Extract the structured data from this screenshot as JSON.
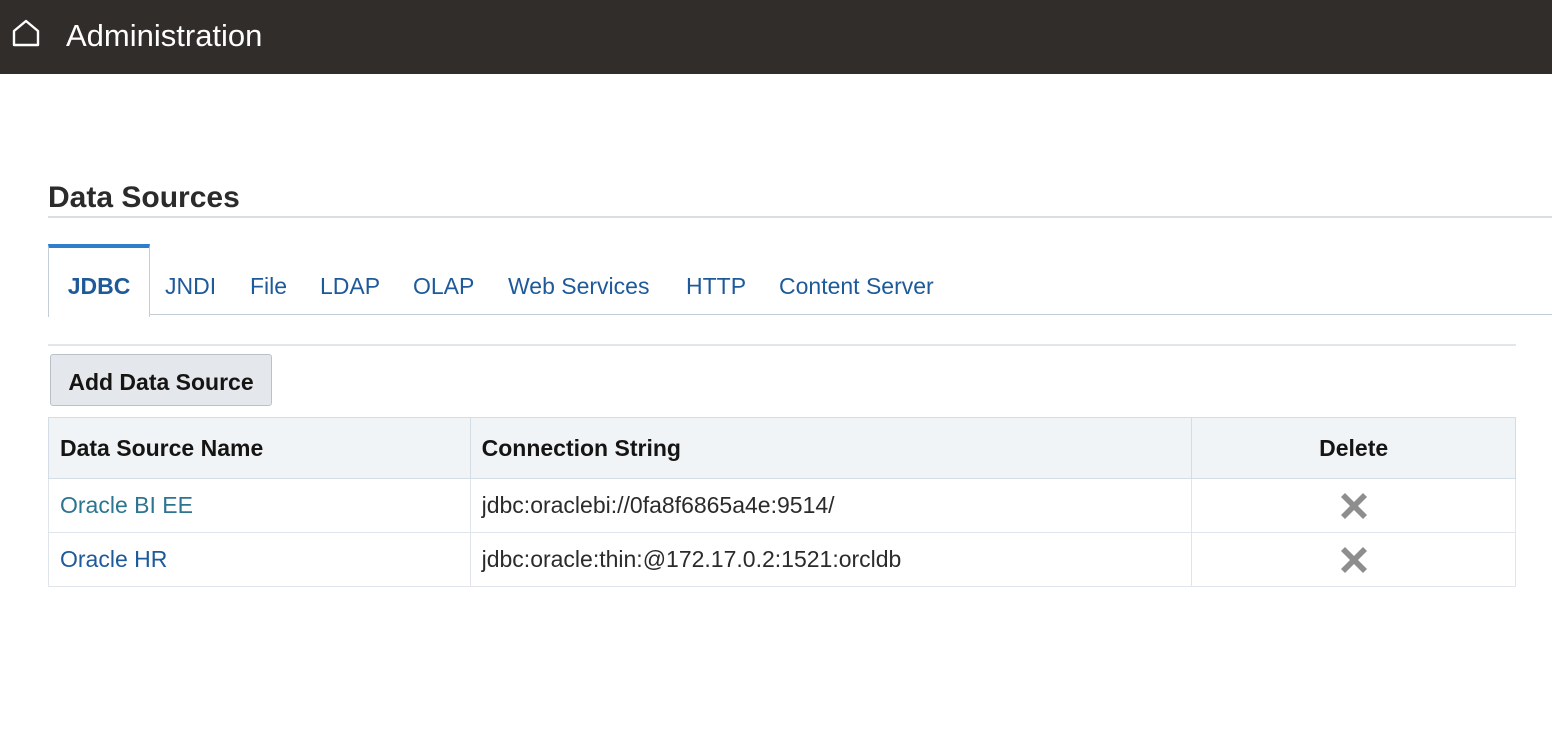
{
  "header": {
    "title": "Administration",
    "icon": "home-icon"
  },
  "page": {
    "title": "Data Sources"
  },
  "tabs": [
    {
      "label": "JDBC",
      "active": true
    },
    {
      "label": "JNDI",
      "active": false
    },
    {
      "label": "File",
      "active": false
    },
    {
      "label": "LDAP",
      "active": false
    },
    {
      "label": "OLAP",
      "active": false
    },
    {
      "label": "Web Services",
      "active": false
    },
    {
      "label": "HTTP",
      "active": false
    },
    {
      "label": "Content Server",
      "active": false
    }
  ],
  "toolbar": {
    "add_label": "Add Data Source"
  },
  "table": {
    "columns": [
      "Data Source Name",
      "Connection String",
      "Delete"
    ],
    "rows": [
      {
        "name": "Oracle BI EE",
        "connection": "jdbc:oraclebi://0fa8f6865a4e:9514/",
        "delete_icon": "close-icon"
      },
      {
        "name": "Oracle HR",
        "connection": "jdbc:oracle:thin:@172.17.0.2:1521:orcldb",
        "delete_icon": "close-icon"
      }
    ]
  },
  "colors": {
    "header_bg": "#312d2a",
    "link": "#1e5a9a",
    "tab_accent": "#2f7ecb",
    "delete_icon": "#8e8e8e"
  }
}
